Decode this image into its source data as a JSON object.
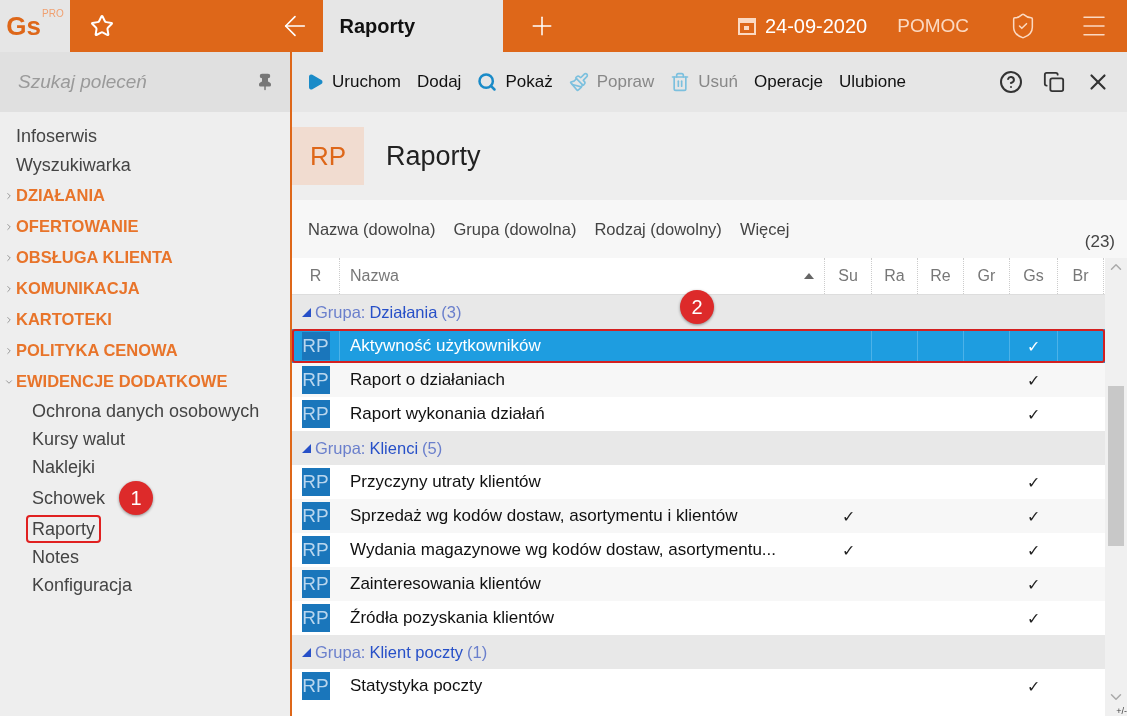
{
  "topbar": {
    "logo": "Gs",
    "logo_sup": "PRO",
    "tab": {
      "label": "Raporty",
      "selected": true
    },
    "date": "24-09-2020",
    "help": "POMOC"
  },
  "sidebar": {
    "search": {
      "placeholder": "Szukaj poleceń"
    },
    "items": [
      {
        "kind": "link",
        "label": "Infoserwis"
      },
      {
        "kind": "link",
        "label": "Wyszukiwarka"
      },
      {
        "kind": "section",
        "label": "DZIAŁANIA",
        "expanded": false
      },
      {
        "kind": "section",
        "label": "OFERTOWANIE",
        "expanded": false
      },
      {
        "kind": "section",
        "label": "OBSŁUGA KLIENTA",
        "expanded": false
      },
      {
        "kind": "section",
        "label": "KOMUNIKACJA",
        "expanded": false
      },
      {
        "kind": "section",
        "label": "KARTOTEKI",
        "expanded": false
      },
      {
        "kind": "section",
        "label": "POLITYKA CENOWA",
        "expanded": false
      },
      {
        "kind": "section",
        "label": "EWIDENCJE DODATKOWE",
        "expanded": true,
        "children": [
          {
            "label": "Ochrona danych osobowych",
            "highlighted": false
          },
          {
            "label": "Kursy walut",
            "highlighted": false
          },
          {
            "label": "Naklejki",
            "highlighted": false
          },
          {
            "label": "Schowek",
            "highlighted": false
          },
          {
            "label": "Raporty",
            "highlighted": true
          },
          {
            "label": "Notes",
            "highlighted": false
          },
          {
            "label": "Konfiguracja",
            "highlighted": false
          }
        ]
      }
    ]
  },
  "toolbar": [
    {
      "label": "Uruchom",
      "disabled": false
    },
    {
      "label": "Dodaj",
      "disabled": false
    },
    {
      "label": "Pokaż",
      "disabled": false
    },
    {
      "label": "Popraw",
      "disabled": true
    },
    {
      "label": "Usuń",
      "disabled": true
    },
    {
      "label": "Operacje",
      "disabled": false
    },
    {
      "label": "Ulubione",
      "disabled": false
    }
  ],
  "header": {
    "badge": "RP",
    "title": "Raporty"
  },
  "filters": [
    "Nazwa (dowolna)",
    "Grupa (dowolna)",
    "Rodzaj (dowolny)",
    "Więcej"
  ],
  "count": "(23)",
  "table": {
    "columns": [
      {
        "label": "R",
        "sorted": false
      },
      {
        "label": "Nazwa",
        "sorted": true
      },
      {
        "label": "Su",
        "sorted": false
      },
      {
        "label": "Ra",
        "sorted": false
      },
      {
        "label": "Re",
        "sorted": false
      },
      {
        "label": "Gr",
        "sorted": false
      },
      {
        "label": "Gs",
        "sorted": false
      },
      {
        "label": "Br",
        "sorted": false
      }
    ],
    "corner_label": "+/-",
    "groups": [
      {
        "prefix": "Grupa:",
        "name": "Działania",
        "count": "(3)",
        "rows": [
          {
            "badge": "RP",
            "name": "Aktywność użytkowników",
            "gs": "✓",
            "selected": true,
            "highlighted": true
          },
          {
            "badge": "RP",
            "name": "Raport o działaniach",
            "gs": "✓",
            "selected": false,
            "highlighted": false
          },
          {
            "badge": "RP",
            "name": "Raport wykonania działań",
            "gs": "✓",
            "selected": false,
            "highlighted": false
          }
        ]
      },
      {
        "prefix": "Grupa:",
        "name": "Klienci",
        "count": "(5)",
        "rows": [
          {
            "badge": "RP",
            "name": "Przyczyny utraty klientów",
            "gs": "✓",
            "selected": false,
            "highlighted": false
          },
          {
            "badge": "RP",
            "name": "Sprzedaż wg kodów dostaw, asortymentu i klientów",
            "su": "✓",
            "gs": "✓",
            "selected": false,
            "highlighted": false
          },
          {
            "badge": "RP",
            "name": "Wydania magazynowe wg kodów dostaw, asortymentu...",
            "su": "✓",
            "gs": "✓",
            "selected": false,
            "highlighted": false
          },
          {
            "badge": "RP",
            "name": "Zainteresowania klientów",
            "gs": "✓",
            "selected": false,
            "highlighted": false
          },
          {
            "badge": "RP",
            "name": "Źródła pozyskania klientów",
            "gs": "✓",
            "selected": false,
            "highlighted": false
          }
        ]
      },
      {
        "prefix": "Grupa:",
        "name": "Klient poczty",
        "count": "(1)",
        "rows": [
          {
            "badge": "RP",
            "name": "Statystyka poczty",
            "gs": "✓",
            "selected": false,
            "highlighted": false
          }
        ]
      }
    ]
  },
  "annotations": [
    {
      "label": "1"
    },
    {
      "label": "2"
    }
  ]
}
